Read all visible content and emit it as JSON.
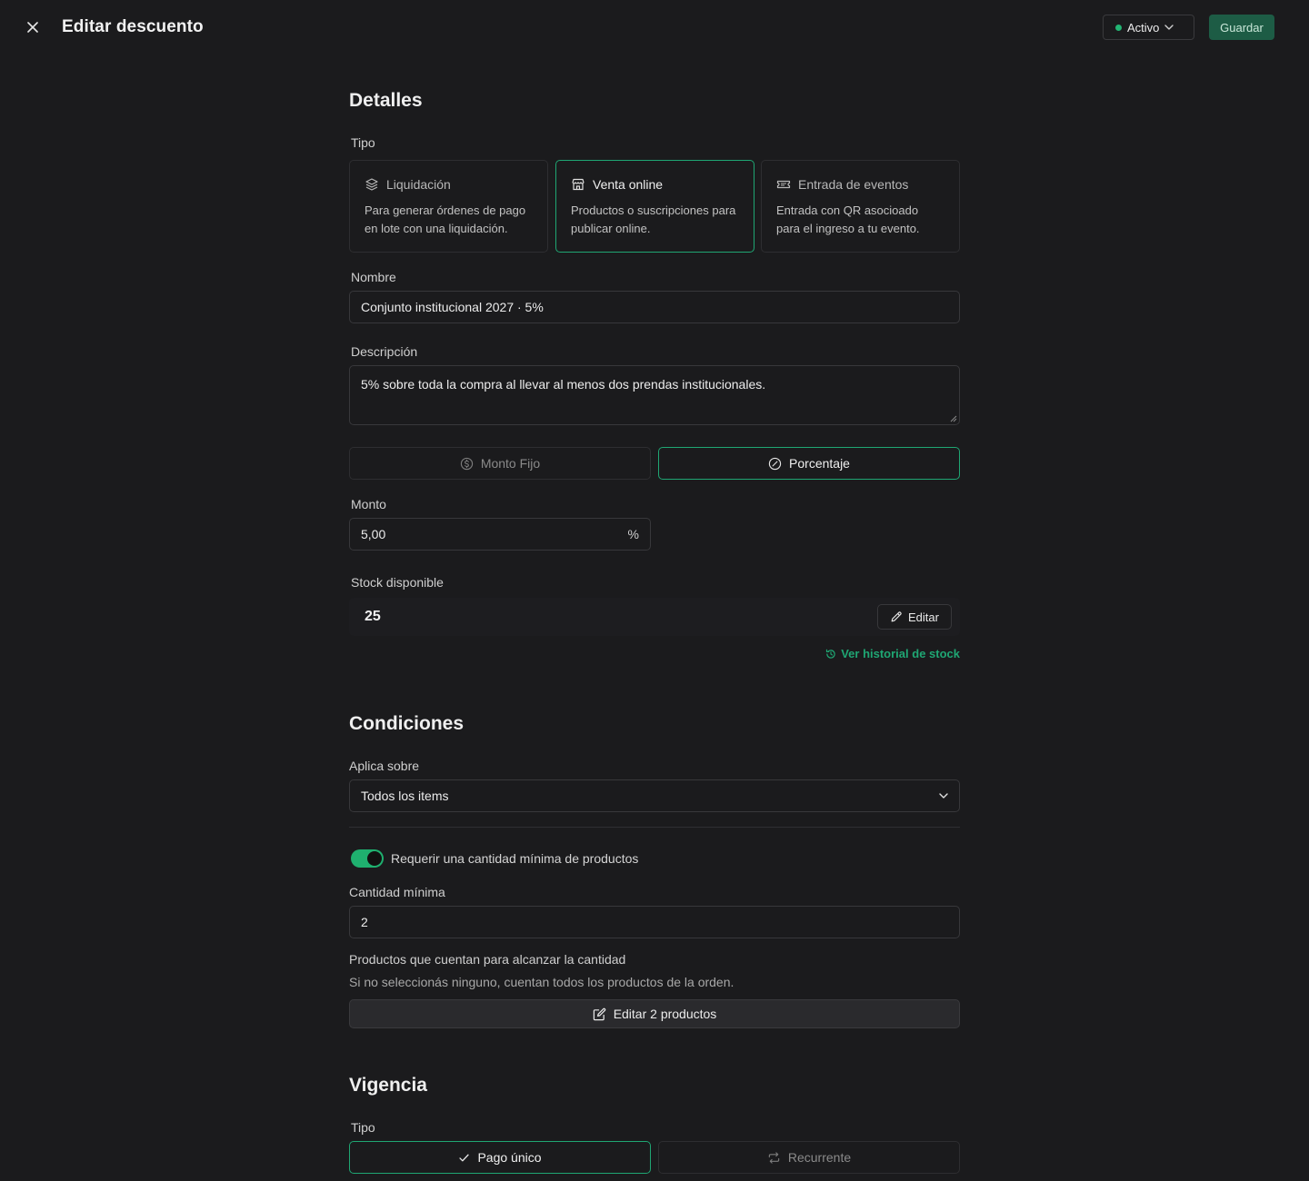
{
  "header": {
    "title": "Editar descuento",
    "status": "Activo",
    "save_label": "Guardar"
  },
  "details": {
    "section_title": "Detalles",
    "type_label": "Tipo",
    "types": [
      {
        "title": "Liquidación",
        "desc": "Para generar órdenes de pago en lote con una liquidación.",
        "icon": "layers-icon"
      },
      {
        "title": "Venta online",
        "desc": "Productos o suscripciones para publicar online.",
        "icon": "store-icon"
      },
      {
        "title": "Entrada de eventos",
        "desc": "Entrada con QR asocioado para el ingreso a tu evento.",
        "icon": "ticket-icon"
      }
    ],
    "selected_type": "Venta online",
    "name_label": "Nombre",
    "name_value": "Conjunto institucional 2027 · 5%",
    "description_label": "Descripción",
    "description_value": "5% sobre toda la compra al llevar al menos dos prendas institucionales.",
    "discount_modes": [
      "Monto Fijo",
      "Porcentaje"
    ],
    "selected_mode": "Porcentaje",
    "amount_label": "Monto",
    "amount_value": "5,00",
    "amount_suffix": "%",
    "stock_label": "Stock disponible",
    "stock_value": "25",
    "edit_label": "Editar",
    "history_link": "Ver historial de stock"
  },
  "conditions": {
    "section_title": "Condiciones",
    "applies_label": "Aplica sobre",
    "applies_value": "Todos los items",
    "min_toggle_label": "Requerir una cantidad mínima de productos",
    "min_toggle_on": true,
    "min_qty_label": "Cantidad mínima",
    "min_qty_value": "2",
    "products_label": "Productos que cuentan para alcanzar la cantidad",
    "products_helper": "Si no seleccionás ninguno, cuentan todos los productos de la orden.",
    "products_button": "Editar 2 productos"
  },
  "validity": {
    "section_title": "Vigencia",
    "type_label": "Tipo",
    "options": [
      "Pago único",
      "Recurrente"
    ],
    "selected": "Pago único"
  },
  "colors": {
    "background": "#1b1b1d",
    "accent": "#1fa673",
    "save_button": "#1d5c45"
  }
}
